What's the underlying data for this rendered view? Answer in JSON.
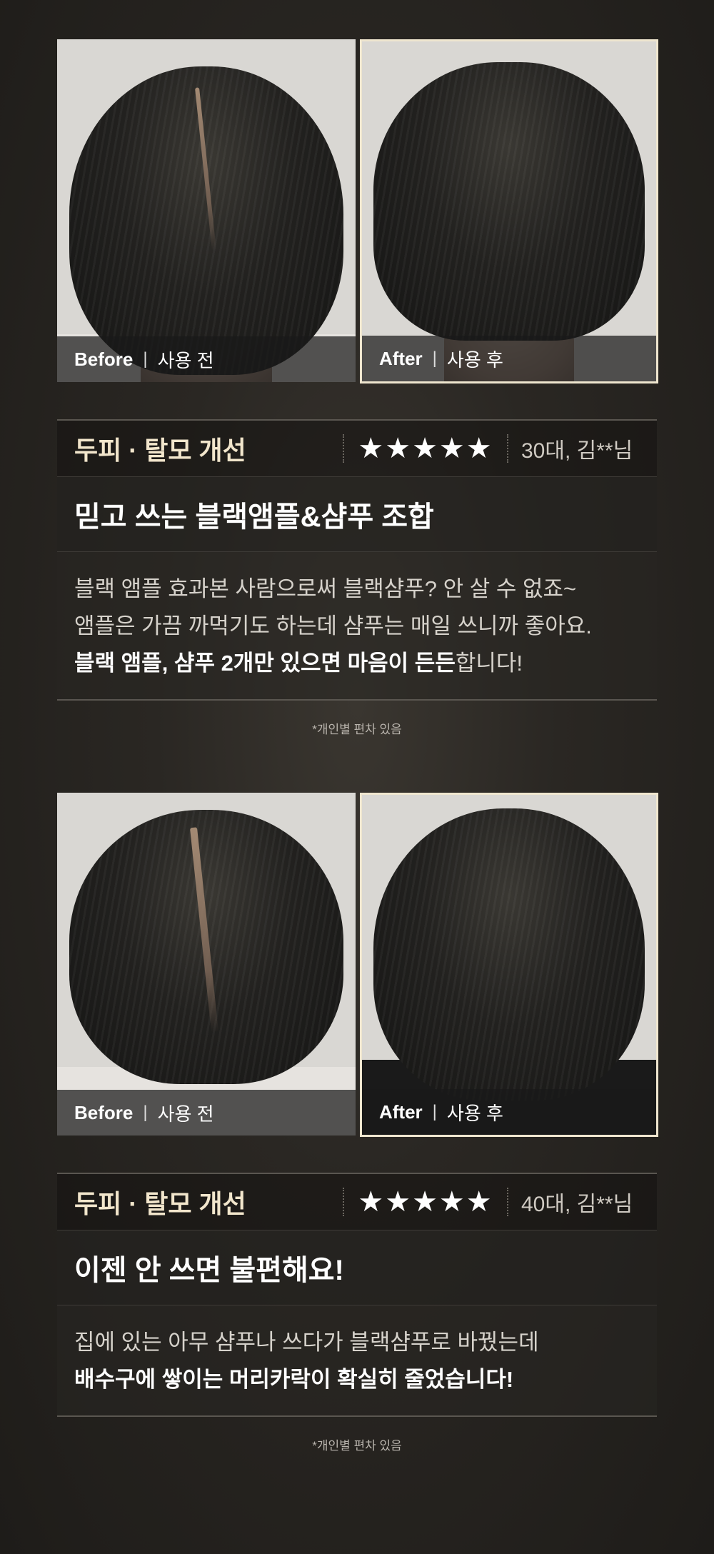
{
  "reviews": [
    {
      "before_label": "Before",
      "before_ko": "사용 전",
      "after_label": "After",
      "after_ko": "사용 후",
      "category": "두피 · 탈모 개선",
      "stars": "★★★★★",
      "rating": 5,
      "reviewer": "30대, 김**님",
      "title": "믿고 쓰는 블랙앰플&샴푸 조합",
      "body": {
        "line1": "블랙 앰플 효과본 사람으로써 블랙샴푸? 안 살 수 없죠~",
        "line2": "앰플은 가끔 까먹기도 하는데 샴푸는 매일 쓰니까 좋아요.",
        "line3_bold": "블랙 앰플, 샴푸 2개만 있으면 마음이 든든",
        "line3_rest": "합니다!"
      },
      "note": "*개인별 편차 있음"
    },
    {
      "before_label": "Before",
      "before_ko": "사용 전",
      "after_label": "After",
      "after_ko": "사용 후",
      "category": "두피 · 탈모 개선",
      "stars": "★★★★★",
      "rating": 5,
      "reviewer": "40대, 김**님",
      "title": "이젠 안 쓰면 불편해요!",
      "body": {
        "line1": "집에 있는 아무 샴푸나 쓰다가 블랙샴푸로 바꿨는데",
        "line2_bold": "배수구에 쌓이는 머리카락이 확실히 줄었습니다!"
      },
      "note": "*개인별 편차 있음"
    }
  ],
  "colors": {
    "accent_frame": "#efe6cf",
    "category_text": "#f2e6cc",
    "background": "#2a2723"
  }
}
